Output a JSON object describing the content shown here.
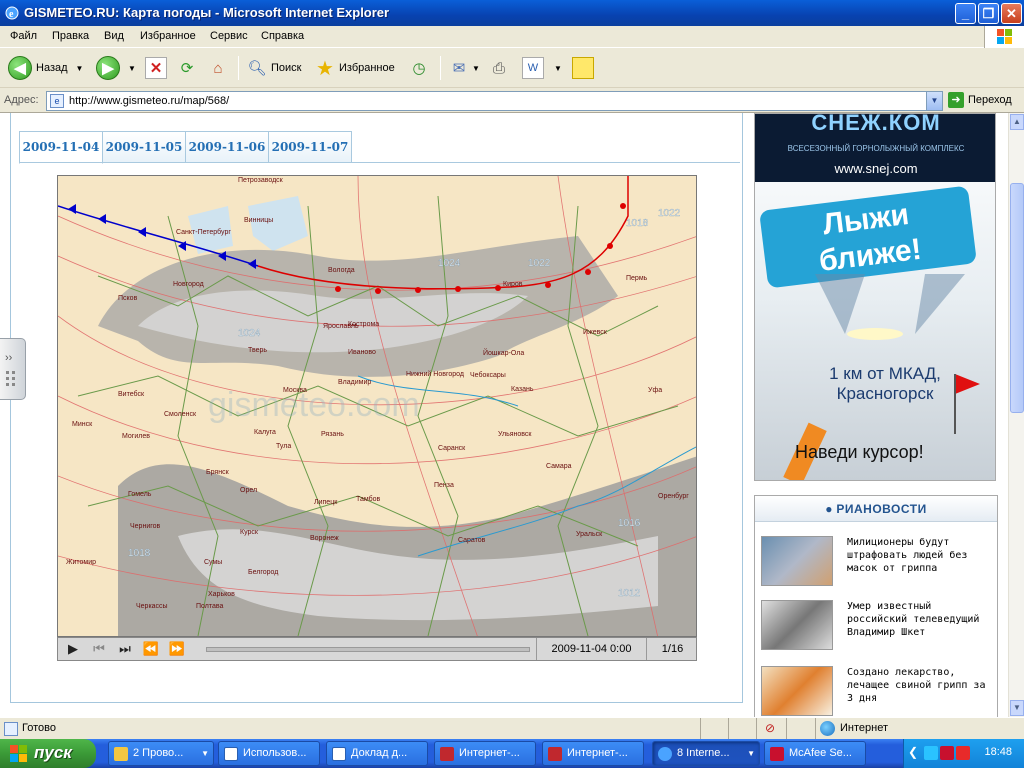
{
  "window": {
    "title": "GISMETEO.RU: Карта погоды - Microsoft Internet Explorer"
  },
  "menu": [
    "Файл",
    "Правка",
    "Вид",
    "Избранное",
    "Сервис",
    "Справка"
  ],
  "toolbar": {
    "back": "Назад",
    "search": "Поиск",
    "favorites": "Избранное"
  },
  "address": {
    "label": "Адрес:",
    "url": "http://www.gismeteo.ru/map/568/",
    "go": "Переход"
  },
  "map_tabs": [
    "2009-11-04",
    "2009-11-05",
    "2009-11-06",
    "2009-11-07"
  ],
  "map": {
    "watermark": "gismeteo.com",
    "cities": [
      "Петрозаводск",
      "Санкт-Петербург",
      "Вологда",
      "Киров",
      "Пермь",
      "Новгород",
      "Псков",
      "Ярославль",
      "Кострома",
      "Ижевск",
      "Тверь",
      "Иваново",
      "Йошкар-Ола",
      "Москва",
      "Владимир",
      "Нижний Новгород",
      "Чебоксары",
      "Казань",
      "Уфа",
      "Витебск",
      "Смоленск",
      "Минск",
      "Могилев",
      "Калуга",
      "Тула",
      "Рязань",
      "Саранск",
      "Ульяновск",
      "Самара",
      "Брянск",
      "Орел",
      "Пенза",
      "Гомель",
      "Липецк",
      "Тамбов",
      "Курск",
      "Оренбург",
      "Чернигов",
      "Воронеж",
      "Саратов",
      "Уральск",
      "Житомир",
      "Сумы",
      "Белгород",
      "Харьков",
      "Черкассы",
      "Полтава",
      "Винницы"
    ],
    "isobars": [
      "1024",
      "1022",
      "1018",
      "1016",
      "1012",
      "1022",
      "1024",
      "1018"
    ]
  },
  "player": {
    "time": "2009-11-04 0:00",
    "frame": "1/16"
  },
  "ad": {
    "brand": "СНЕЖ.КОМ",
    "subtitle": "ВСЕСЕЗОННЫЙ ГОРНОЛЫЖНЫЙ КОМПЛЕКС",
    "site": "www.snej.com",
    "slogan_1": "Лыжи",
    "slogan_2": "ближе!",
    "distance_1": "1 км от МКАД,",
    "distance_2": "Красногорск",
    "cta": "Наведи курсор!"
  },
  "news": {
    "source": "РИАНОВОСТИ",
    "items": [
      "Милиционеры будут штрафовать людей без масок от гриппа",
      "Умер известный российский телеведущий Владимир Шкет",
      "Создано лекарство, лечащее свиной грипп за 3 дня"
    ]
  },
  "status": {
    "text": "Готово",
    "zone": "Интернет"
  },
  "taskbar": {
    "start": "пуск",
    "tasks": [
      "2 Прово...",
      "Использов...",
      "Доклад д...",
      "Интернет-...",
      "Интернет-...",
      "8 Interne...",
      "McAfee Se..."
    ],
    "clock": "18:48"
  },
  "colors": {
    "title_blue": "#0842b0",
    "tab_text": "#246fb4",
    "cold_front": "#0000cc",
    "warm_front": "#dd0000"
  }
}
